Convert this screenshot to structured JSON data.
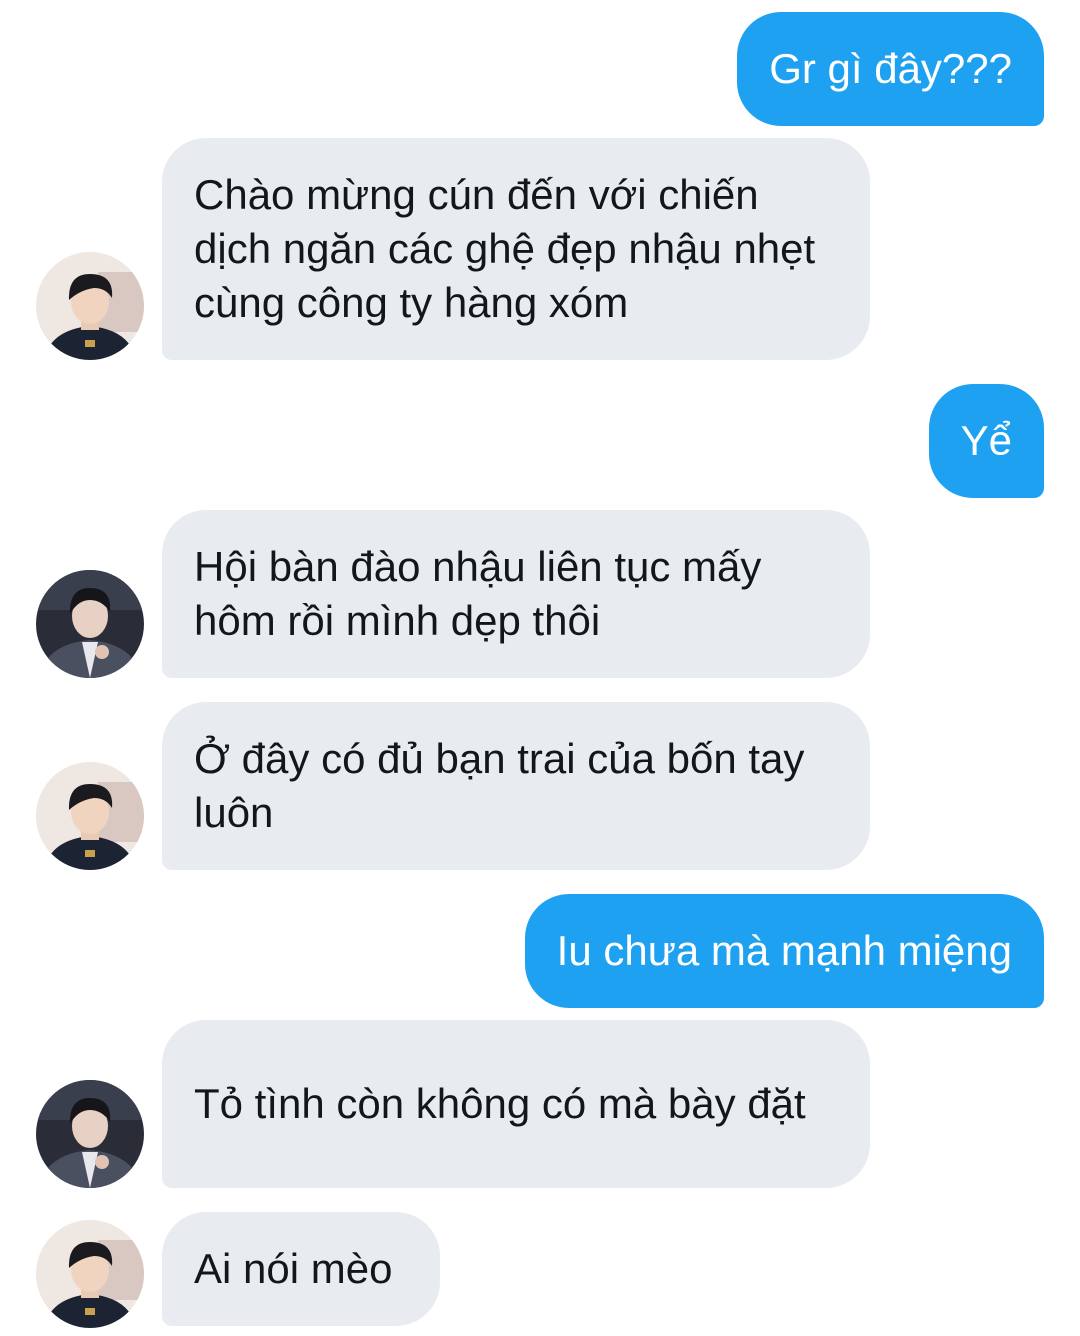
{
  "messages": [
    {
      "dir": "out",
      "text": "Gr gì đây???"
    },
    {
      "dir": "in",
      "avatar": "avatar-a",
      "text": "Chào mừng cún đến với chiến dịch ngăn các ghệ đẹp nhậu nhẹt cùng công ty hàng xóm"
    },
    {
      "dir": "out",
      "text": "Yể"
    },
    {
      "dir": "in",
      "avatar": "avatar-b",
      "text": "Hội bàn đào nhậu liên tục mấy hôm rồi mình dẹp thôi"
    },
    {
      "dir": "in",
      "avatar": "avatar-a",
      "text": "Ở đây có đủ bạn trai của bốn tay luôn"
    },
    {
      "dir": "out",
      "text": "Iu chưa mà mạnh miệng"
    },
    {
      "dir": "in",
      "avatar": "avatar-b",
      "text": "Tỏ tình còn không có mà bày đặt"
    },
    {
      "dir": "in",
      "avatar": "avatar-a",
      "text": "Ai nói mèo"
    }
  ],
  "colors": {
    "outgoing_bubble": "#1fa1f1",
    "incoming_bubble": "#e8ecf0",
    "incoming_text": "#14171a",
    "outgoing_text": "#ffffff"
  }
}
